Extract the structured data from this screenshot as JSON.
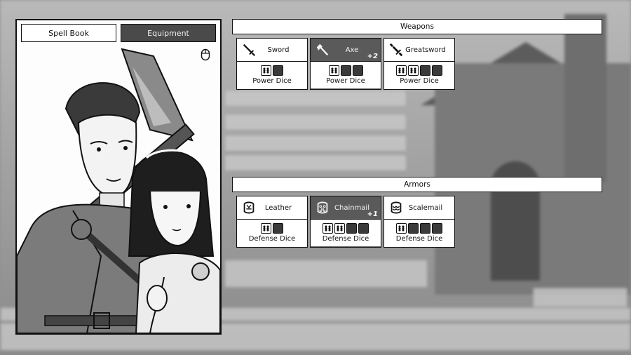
{
  "tabs": [
    {
      "label": "Spell Book",
      "active": true
    },
    {
      "label": "Equipment",
      "active": false
    }
  ],
  "weapons": {
    "title": "Weapons",
    "items": [
      {
        "name": "Sword",
        "icon": "sword-icon",
        "filled": 1,
        "empty": 1,
        "label": "Power Dice",
        "selected": false,
        "badge": ""
      },
      {
        "name": "Axe",
        "icon": "axe-icon",
        "filled": 1,
        "empty": 2,
        "label": "Power Dice",
        "selected": true,
        "badge": "+2"
      },
      {
        "name": "Greatsword",
        "icon": "greatsword-icon",
        "filled": 2,
        "empty": 2,
        "label": "Power Dice",
        "selected": false,
        "badge": ""
      }
    ]
  },
  "armors": {
    "title": "Armors",
    "items": [
      {
        "name": "Leather",
        "icon": "leather-armor-icon",
        "filled": 1,
        "empty": 1,
        "label": "Defense Dice",
        "selected": false,
        "badge": ""
      },
      {
        "name": "Chainmail",
        "icon": "chainmail-icon",
        "filled": 2,
        "empty": 2,
        "label": "Defense Dice",
        "selected": true,
        "badge": "+1"
      },
      {
        "name": "Scalemail",
        "icon": "scalemail-icon",
        "filled": 1,
        "empty": 3,
        "label": "Defense Dice",
        "selected": false,
        "badge": ""
      }
    ]
  },
  "colors": {
    "selected": "#5a5a5a",
    "border": "#111111",
    "background": "#8f8f8f"
  }
}
